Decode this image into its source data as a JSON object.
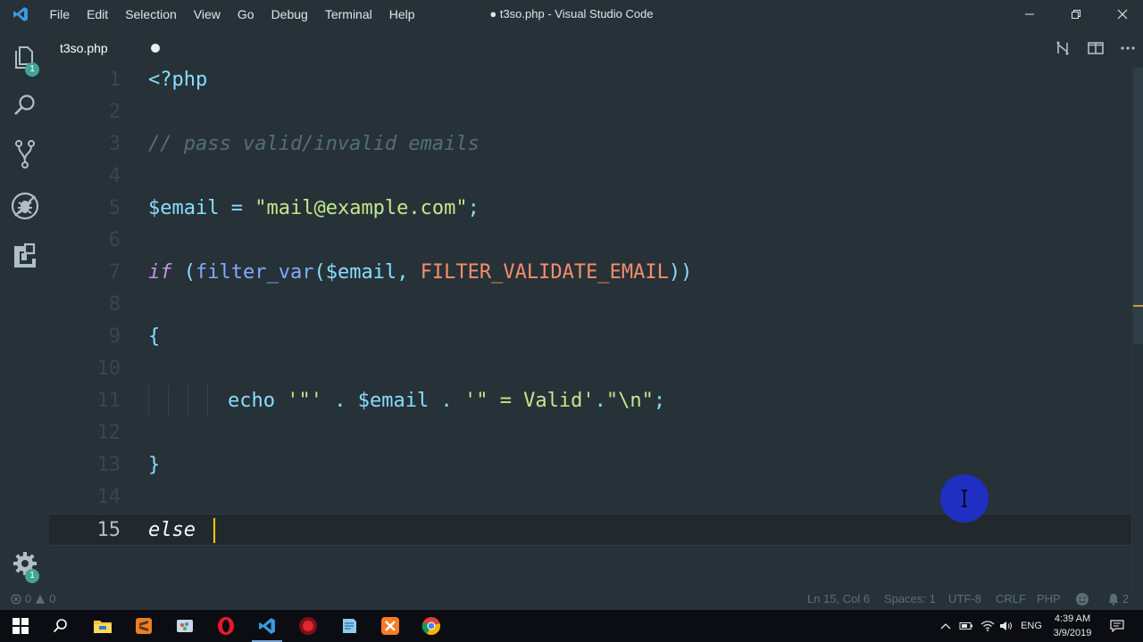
{
  "titlebar": {
    "menu": [
      "File",
      "Edit",
      "Selection",
      "View",
      "Go",
      "Debug",
      "Terminal",
      "Help"
    ],
    "title": "● t3so.php - Visual Studio Code"
  },
  "activity": {
    "explorer_badge": "1",
    "settings_badge": "1"
  },
  "tab": {
    "label": "t3so.php"
  },
  "editor": {
    "line_numbers": [
      "1",
      "2",
      "3",
      "4",
      "5",
      "6",
      "7",
      "8",
      "9",
      "10",
      "11",
      "12",
      "13",
      "14",
      "15"
    ],
    "current_line": 15
  },
  "code": {
    "l1_tag": "<?php",
    "l3_comment": "// pass valid/invalid emails",
    "l5_var": "$email",
    "l5_eq": " = ",
    "l5_str": "\"mail@example.com\"",
    "l5_semi": ";",
    "l7_if": "if",
    "l7_paren": " (",
    "l7_fn": "filter_var",
    "l7_open": "(",
    "l7_var": "$email",
    "l7_comma": ", ",
    "l7_const": "FILTER_VALIDATE_EMAIL",
    "l7_close": "))",
    "l9_brace": "{",
    "l11_echo": "echo",
    "l11_s1": " '\"' ",
    "l11_dot1": ". ",
    "l11_var": "$email",
    "l11_dot2": " . ",
    "l11_s2": "'\" = Valid'",
    "l11_dot3": ".",
    "l11_s3": "\"\\n\"",
    "l11_semi": ";",
    "l13_brace": "}",
    "l15_else": "else "
  },
  "statusbar": {
    "errors": "0",
    "warnings": "0",
    "position": "Ln 15, Col 6",
    "spaces": "Spaces: 1",
    "encoding": "UTF-8",
    "eol": "CRLF",
    "language": "PHP",
    "notifications": "2"
  },
  "taskbar": {
    "language": "ENG",
    "time": "4:39 AM",
    "date": "3/9/2019"
  },
  "colors": {
    "background": "#263238",
    "cursor": "#ffcc00",
    "mouse_highlight": "#1f2fc9"
  }
}
